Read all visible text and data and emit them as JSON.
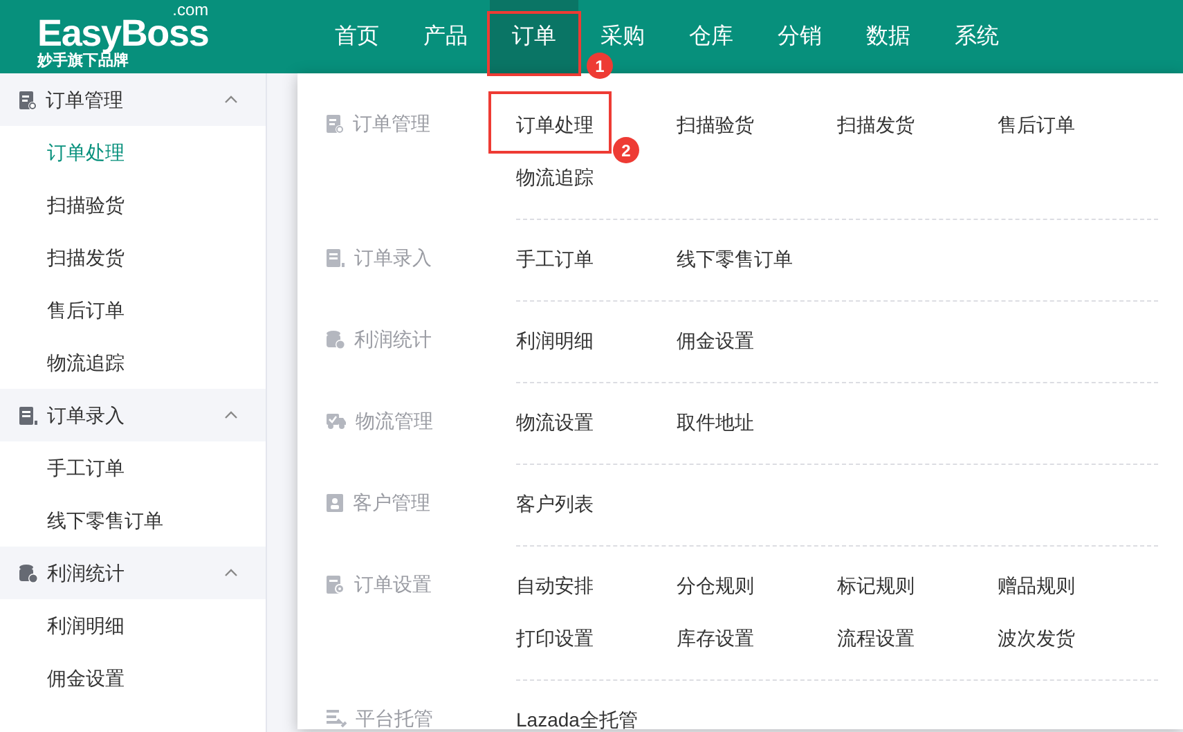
{
  "logo": {
    "name": "EasyBoss",
    "domain": ".com",
    "tagline": "妙手旗下品牌"
  },
  "nav": [
    {
      "label": "首页",
      "selected": false
    },
    {
      "label": "产品",
      "selected": false
    },
    {
      "label": "订单",
      "selected": true,
      "callout": "1"
    },
    {
      "label": "采购",
      "selected": false
    },
    {
      "label": "仓库",
      "selected": false
    },
    {
      "label": "分销",
      "selected": false
    },
    {
      "label": "数据",
      "selected": false
    },
    {
      "label": "系统",
      "selected": false
    }
  ],
  "sidebar": {
    "groups": [
      {
        "label": "订单管理",
        "expanded": true,
        "items": [
          {
            "label": "订单处理",
            "selected": true
          },
          {
            "label": "扫描验货",
            "selected": false
          },
          {
            "label": "扫描发货",
            "selected": false
          },
          {
            "label": "售后订单",
            "selected": false
          },
          {
            "label": "物流追踪",
            "selected": false
          }
        ]
      },
      {
        "label": "订单录入",
        "expanded": true,
        "items": [
          {
            "label": "手工订单",
            "selected": false
          },
          {
            "label": "线下零售订单",
            "selected": false
          }
        ]
      },
      {
        "label": "利润统计",
        "expanded": true,
        "items": [
          {
            "label": "利润明细",
            "selected": false
          },
          {
            "label": "佣金设置",
            "selected": false
          }
        ]
      }
    ]
  },
  "dropdown": {
    "sections": [
      {
        "label": "订单管理",
        "items": [
          {
            "label": "订单处理",
            "callout": "2"
          },
          {
            "label": "扫描验货"
          },
          {
            "label": "扫描发货"
          },
          {
            "label": "售后订单"
          },
          {
            "label": "物流追踪"
          }
        ]
      },
      {
        "label": "订单录入",
        "items": [
          {
            "label": "手工订单"
          },
          {
            "label": "线下零售订单"
          }
        ]
      },
      {
        "label": "利润统计",
        "items": [
          {
            "label": "利润明细"
          },
          {
            "label": "佣金设置"
          }
        ]
      },
      {
        "label": "物流管理",
        "items": [
          {
            "label": "物流设置"
          },
          {
            "label": "取件地址"
          }
        ]
      },
      {
        "label": "客户管理",
        "items": [
          {
            "label": "客户列表"
          }
        ]
      },
      {
        "label": "订单设置",
        "items": [
          {
            "label": "自动安排"
          },
          {
            "label": "分仓规则"
          },
          {
            "label": "标记规则"
          },
          {
            "label": "赠品规则"
          },
          {
            "label": "打印设置"
          },
          {
            "label": "库存设置"
          },
          {
            "label": "流程设置"
          },
          {
            "label": "波次发货"
          }
        ]
      },
      {
        "label": "平台托管",
        "items": [
          {
            "label": "Lazada全托管"
          }
        ]
      }
    ]
  }
}
